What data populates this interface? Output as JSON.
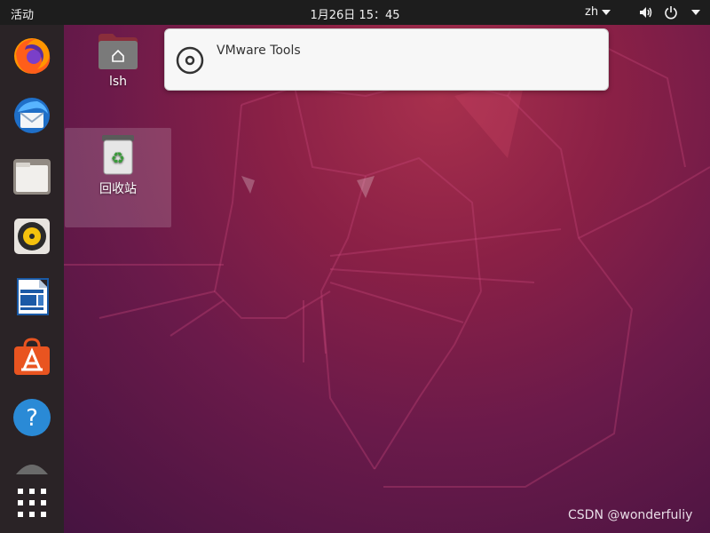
{
  "topbar": {
    "activities": "活动",
    "clock": "1月26日  15：45",
    "language": "zh"
  },
  "dock": {
    "items": [
      {
        "name": "firefox-icon"
      },
      {
        "name": "thunderbird-icon"
      },
      {
        "name": "files-icon"
      },
      {
        "name": "rhythmbox-icon"
      },
      {
        "name": "libreoffice-writer-icon"
      },
      {
        "name": "ubuntu-software-icon"
      },
      {
        "name": "help-icon"
      }
    ],
    "help_glyph": "?"
  },
  "desktop": {
    "home_label": "lsh",
    "trash_label": "回收站"
  },
  "notification": {
    "title": "VMware Tools"
  },
  "watermark": "CSDN @wonderfuliy",
  "colors": {
    "topbar": "#1d1d1d",
    "dock": "#2a2326",
    "ubuntu_orange": "#e95420",
    "help_blue": "#2a8ad6"
  }
}
